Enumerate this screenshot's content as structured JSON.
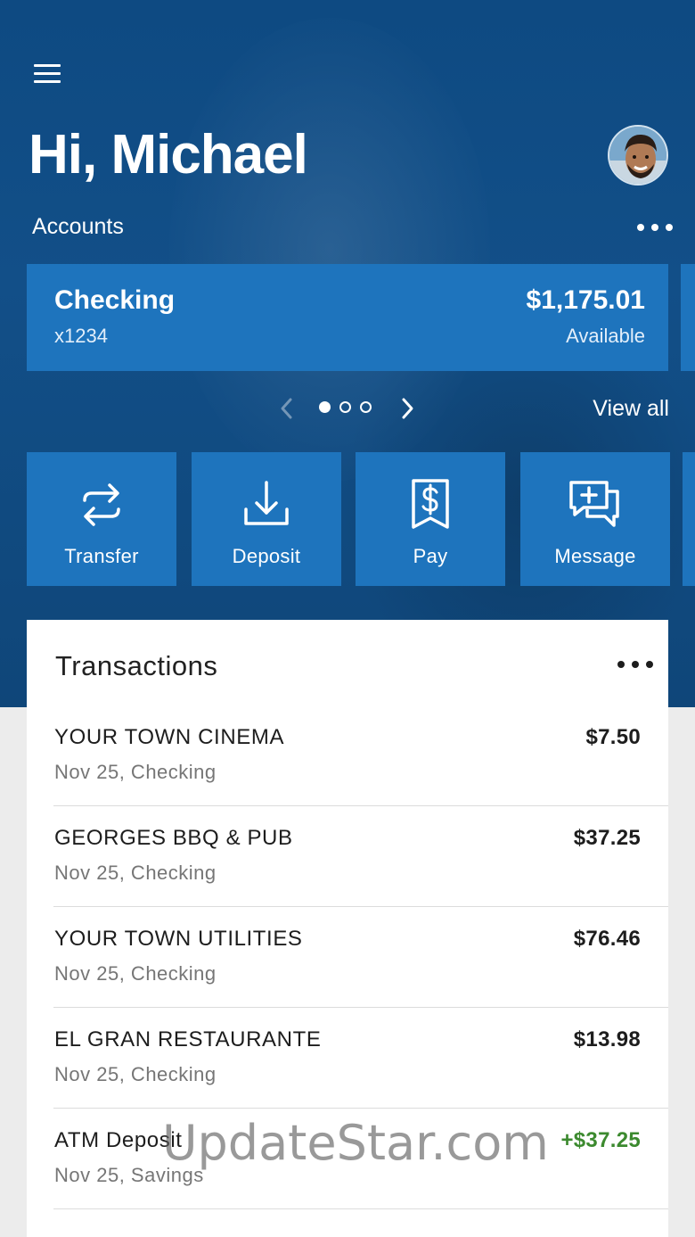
{
  "header": {
    "greeting": "Hi, Michael",
    "menu_icon": "hamburger-menu-icon",
    "avatar_icon": "user-avatar"
  },
  "accounts": {
    "label": "Accounts",
    "more_icon": "more-horizontal-icon",
    "cards": [
      {
        "name": "Checking",
        "number": "x1234",
        "balance": "$1,175.01",
        "balance_label": "Available"
      }
    ],
    "pager": {
      "page_count": 3,
      "current_page": 1
    },
    "view_all": "View all"
  },
  "actions": [
    {
      "label": "Transfer",
      "icon": "transfer-arrows-icon"
    },
    {
      "label": "Deposit",
      "icon": "download-tray-icon"
    },
    {
      "label": "Pay",
      "icon": "receipt-dollar-icon"
    },
    {
      "label": "Message",
      "icon": "chat-plus-icon"
    }
  ],
  "transactions": {
    "title": "Transactions",
    "items": [
      {
        "name": "YOUR TOWN CINEMA",
        "detail": "Nov 25, Checking",
        "amount": "$7.50"
      },
      {
        "name": "GEORGES BBQ & PUB",
        "detail": "Nov 25, Checking",
        "amount": "$37.25"
      },
      {
        "name": "YOUR TOWN UTILITIES",
        "detail": "Nov 25, Checking",
        "amount": "$76.46"
      },
      {
        "name": "EL GRAN RESTAURANTE",
        "detail": "Nov 25, Checking",
        "amount": "$13.98"
      },
      {
        "name": "ATM Deposit",
        "detail": "Nov 25, Savings",
        "amount": "+$37.25"
      }
    ]
  },
  "watermark": "UpdateStar.com",
  "colors": {
    "hero_bg": "#124f88",
    "tile_blue": "#1e74bd",
    "positive_amount": "#3c8a2f"
  }
}
